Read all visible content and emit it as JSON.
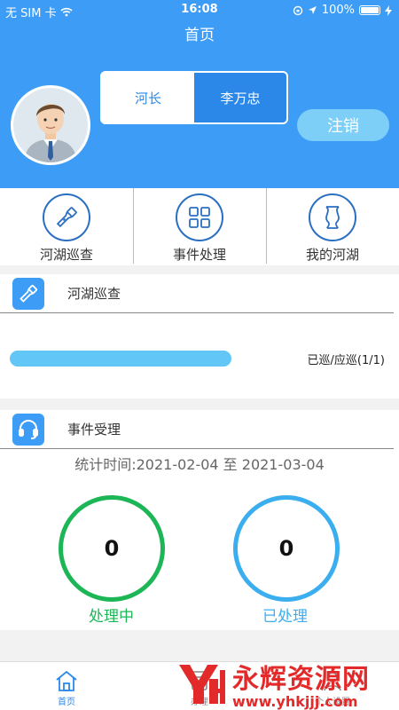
{
  "status_bar": {
    "carrier": "无 SIM 卡",
    "time": "16:08",
    "battery": "100%"
  },
  "nav": {
    "title": "首页"
  },
  "user": {
    "role_options": [
      "河长",
      "李万忠"
    ],
    "selected_role": "李万忠",
    "logout_label": "注销"
  },
  "quick_actions": [
    {
      "label": "河湖巡查",
      "icon": "flashlight-icon"
    },
    {
      "label": "事件处理",
      "icon": "grid-icon"
    },
    {
      "label": "我的河湖",
      "icon": "river-icon"
    }
  ],
  "patrol_card": {
    "title": "河湖巡查",
    "progress_text": "已巡/应巡(1/1)",
    "progress_percent": 100
  },
  "events_card": {
    "title": "事件受理",
    "period": "统计时间:2021-02-04 至 2021-03-04",
    "processing_count": "0",
    "processing_label": "处理中",
    "processed_count": "0",
    "processed_label": "已处理"
  },
  "tabbar": {
    "items": [
      {
        "label": "首页",
        "active": true
      },
      {
        "label": "办理"
      },
      {
        "label": "个人设置"
      }
    ]
  },
  "watermark": {
    "title": "永辉资源网",
    "url": "www.yhkjjj.com"
  },
  "colors": {
    "primary": "#3d9cf5",
    "accent_dark": "#2b88e8",
    "green": "#1db656",
    "light_blue": "#3baef0"
  }
}
